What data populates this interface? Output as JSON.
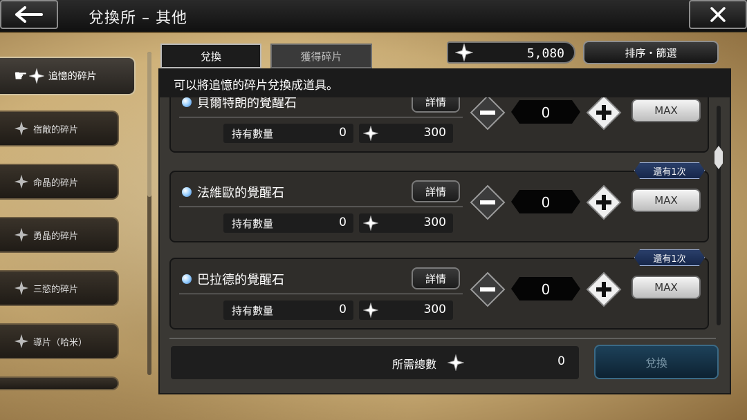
{
  "header": {
    "title": "兌換所 – 其他"
  },
  "sidebar": {
    "items": [
      {
        "label": "追憶的碎片",
        "active": true
      },
      {
        "label": "宿敵的碎片",
        "active": false
      },
      {
        "label": "命晶的碎片",
        "active": false
      },
      {
        "label": "勇晶的碎片",
        "active": false
      },
      {
        "label": "三慾的碎片",
        "active": false
      },
      {
        "label": "導片（哈米）",
        "active": false
      }
    ]
  },
  "tabs": [
    {
      "label": "兌換",
      "active": true
    },
    {
      "label": "獲得碎片",
      "active": false
    }
  ],
  "currency": {
    "value": "5,080"
  },
  "sort_button": {
    "label": "排序・篩選"
  },
  "description": "可以將追憶的碎片兌換成道具。",
  "items": [
    {
      "name": "貝爾特朗的覺醒石",
      "detail_label": "詳情",
      "hold_label": "持有數量",
      "hold_value": "0",
      "cost": "300",
      "quantity": "0",
      "max_label": "MAX",
      "remaining": ""
    },
    {
      "name": "法維歐的覺醒石",
      "detail_label": "詳情",
      "hold_label": "持有數量",
      "hold_value": "0",
      "cost": "300",
      "quantity": "0",
      "max_label": "MAX",
      "remaining": "還有1次"
    },
    {
      "name": "巴拉德的覺醒石",
      "detail_label": "詳情",
      "hold_label": "持有數量",
      "hold_value": "0",
      "cost": "300",
      "quantity": "0",
      "max_label": "MAX",
      "remaining": "還有1次"
    }
  ],
  "footer": {
    "total_label": "所需總數",
    "total_value": "0",
    "confirm_label": "兌換"
  },
  "icons": {
    "back": "arrow-left-icon",
    "close": "close-icon",
    "currency": "shard-sparkle-icon",
    "pointer": "pointing-hand-icon"
  }
}
